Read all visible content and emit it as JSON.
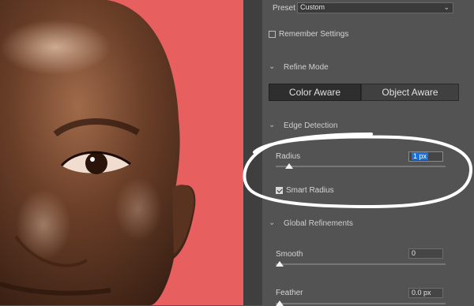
{
  "preset": {
    "label": "Preset",
    "value": "Custom"
  },
  "remember": {
    "label": "Remember Settings",
    "checked": false
  },
  "refine_mode": {
    "title": "Refine Mode",
    "options": [
      "Color Aware",
      "Object Aware"
    ],
    "selected": "Color Aware"
  },
  "edge_detection": {
    "title": "Edge Detection",
    "radius": {
      "label": "Radius",
      "value": "1 px",
      "slider_fraction": 0.03
    },
    "smart_radius": {
      "label": "Smart Radius",
      "checked": true
    }
  },
  "global_refinements": {
    "title": "Global Refinements",
    "smooth": {
      "label": "Smooth",
      "value": "0",
      "slider_fraction": 0.0
    },
    "feather": {
      "label": "Feather",
      "value": "0.0 px",
      "slider_fraction": 0.0
    }
  },
  "colors": {
    "panel_bg": "#535353",
    "panel_gutter": "#3f3f3f",
    "photo_bg": "#e85f5f",
    "selection_blue": "#1c6fd6",
    "annotation_stroke": "#ffffff"
  }
}
